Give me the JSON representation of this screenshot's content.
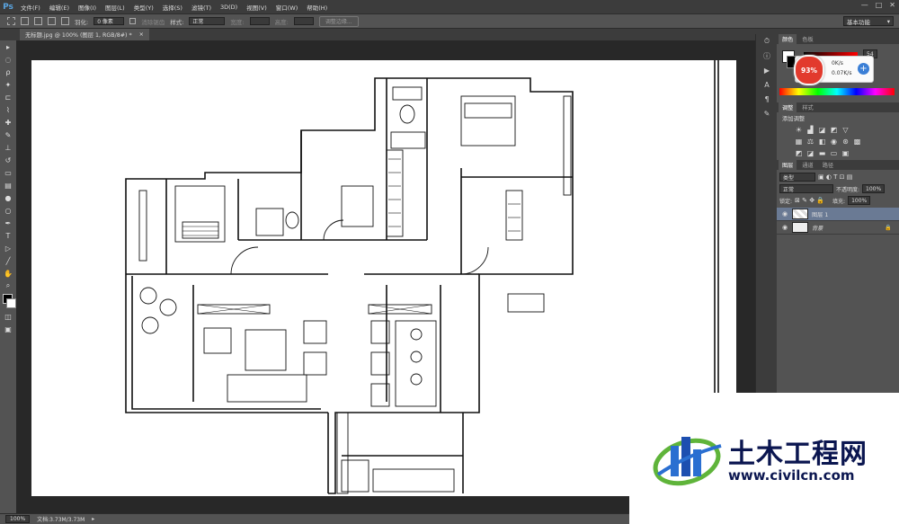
{
  "app": {
    "logo": "Ps"
  },
  "menu": [
    "文件(F)",
    "编辑(E)",
    "图像(I)",
    "图层(L)",
    "类型(Y)",
    "选择(S)",
    "滤镜(T)",
    "3D(D)",
    "视图(V)",
    "窗口(W)",
    "帮助(H)"
  ],
  "window_controls": [
    "—",
    "□",
    "✕"
  ],
  "options_bar": {
    "feather_label": "羽化:",
    "feather_value": "0 像素",
    "antialias_label": "消除锯齿",
    "style_label": "样式:",
    "style_value": "正常",
    "width_label": "宽度:",
    "height_label": "高度:",
    "refine_button": "调整边缘..."
  },
  "workspace": {
    "value": "基本功能"
  },
  "document_tab": {
    "title": "无标题.jpg @ 100% (图层 1, RGB/8#) *",
    "close": "×"
  },
  "status": {
    "zoom": "100%",
    "doc": "文档:3.73M/3.73M"
  },
  "panels": {
    "color_tabs": [
      "颜色",
      "色板"
    ],
    "color_r": "54",
    "adjust_tabs": [
      "调整",
      "样式"
    ],
    "adjust_title": "添加调整",
    "layers_tabs": [
      "图层",
      "通道",
      "路径"
    ],
    "kind_value": "类型",
    "blend_value": "正常",
    "opacity_label": "不透明度:",
    "opacity_value": "100%",
    "lock_label": "锁定:",
    "fill_label": "填充:",
    "fill_value": "100%",
    "layers": [
      {
        "name": "图层 1",
        "selected": true
      },
      {
        "name": "背景",
        "locked": true
      }
    ]
  },
  "net_widget": {
    "percent": "93%",
    "upload": "0K/s",
    "download": "0.07K/s",
    "plus": "+"
  },
  "watermark": {
    "name": "土木工程网",
    "url": "www.civilcn.com"
  },
  "colors": {
    "panel": "#535353",
    "dark": "#3c3c3c",
    "canvas_bg": "#282828",
    "selected_layer": "#6a7a94",
    "brand_navy": "#0b1650",
    "brand_blue": "#2a6fd1",
    "brand_green": "#5fb43a",
    "widget_red": "#e23a2d"
  }
}
